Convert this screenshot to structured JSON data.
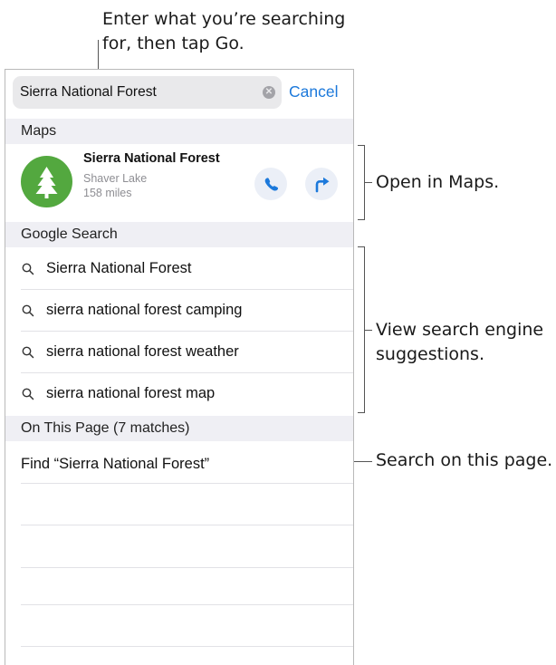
{
  "callouts": {
    "top_line1": "Enter what you’re searching",
    "top_line2": "for, then tap Go.",
    "maps": "Open in Maps.",
    "suggestions_line1": "View search engine",
    "suggestions_line2": "suggestions.",
    "find": "Search on this page."
  },
  "search": {
    "value": "Sierra National Forest",
    "cancel_label": "Cancel"
  },
  "sections": {
    "maps": "Maps",
    "google": "Google Search",
    "on_this_page": "On This Page (7 matches)"
  },
  "maps_result": {
    "title": "Sierra National Forest",
    "location": "Shaver Lake",
    "distance": "158 miles",
    "icon": "tree-icon",
    "accent_color": "#53a83f"
  },
  "suggestions": [
    {
      "text": "Sierra National Forest"
    },
    {
      "text": "sierra national forest camping"
    },
    {
      "text": "sierra national forest weather"
    },
    {
      "text": "sierra national forest map"
    }
  ],
  "find": {
    "text": "Find “Sierra National Forest”"
  },
  "colors": {
    "link_blue": "#1c79db",
    "section_bg": "#efeff4"
  }
}
